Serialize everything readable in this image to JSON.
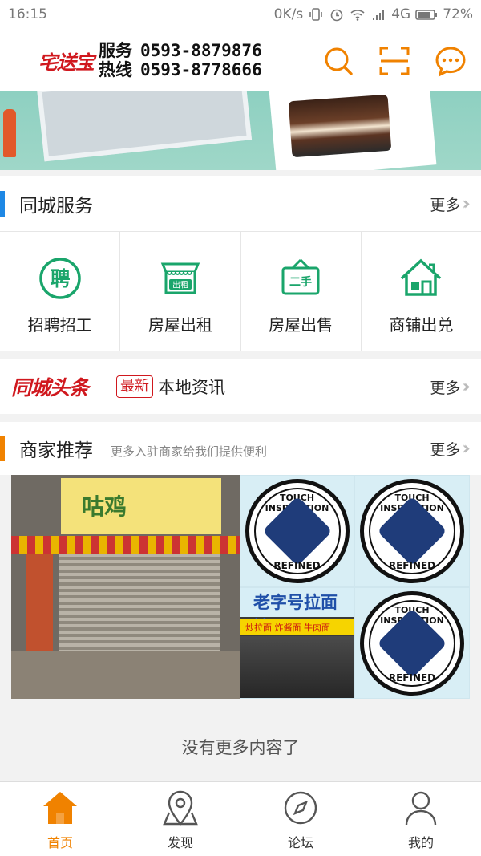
{
  "status_bar": {
    "time": "16:15",
    "speed": "0K/s",
    "network": "4G",
    "battery": "72%"
  },
  "header": {
    "brand": "宅送宝",
    "hotline_label_1": "服务",
    "hotline_label_2": "热线",
    "phone_1": "0593-8879876",
    "phone_2": "0593-8778666",
    "icons": [
      "search-icon",
      "scan-icon",
      "message-icon"
    ],
    "accent_color": "#f08200"
  },
  "city_services": {
    "title": "同城服务",
    "more": "更多",
    "accent_color": "#1e88e5",
    "items": [
      {
        "label": "招聘招工",
        "icon": "recruit-icon",
        "glyph": "聘"
      },
      {
        "label": "房屋出租",
        "icon": "house-rent-icon",
        "glyph": "出租"
      },
      {
        "label": "房屋出售",
        "icon": "house-sale-icon",
        "glyph": "二手"
      },
      {
        "label": "商铺出兑",
        "icon": "shop-transfer-icon"
      }
    ]
  },
  "headlines": {
    "logo": "同城头条",
    "badge": "最新",
    "text": "本地资讯",
    "more": "更多"
  },
  "merchants": {
    "title": "商家推荐",
    "subtitle": "更多入驻商家给我们提供便利",
    "more": "更多",
    "accent_color": "#f08200",
    "shop_1_sign": "咕鸡",
    "shop_2_sign": "老字号拉面馆",
    "shop_2_stripe": "炒拉面 炸酱面 牛肉面",
    "seal_top": "TOUCH INSPIRATION",
    "seal_bottom": "REFINED"
  },
  "end_text": "没有更多内容了",
  "tabbar": {
    "active_color": "#f08200",
    "tabs": [
      {
        "label": "首页",
        "icon": "home-icon",
        "active": true
      },
      {
        "label": "发现",
        "icon": "location-icon",
        "active": false
      },
      {
        "label": "论坛",
        "icon": "compass-icon",
        "active": false
      },
      {
        "label": "我的",
        "icon": "user-icon",
        "active": false
      }
    ]
  }
}
